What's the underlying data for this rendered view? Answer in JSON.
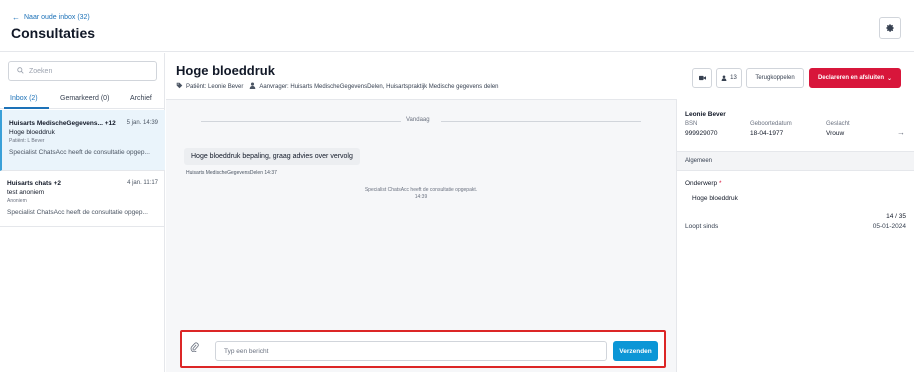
{
  "header": {
    "back_link": "Naar oude inbox (32)",
    "title": "Consultaties"
  },
  "sidebar": {
    "search_placeholder": "Zoeken",
    "tabs": [
      {
        "label": "Inbox (2)",
        "active": true
      },
      {
        "label": "Gemarkeerd (0)",
        "active": false
      },
      {
        "label": "Archief",
        "active": false
      }
    ],
    "conversations": [
      {
        "sender": "Huisarts MedischeGegevens...",
        "extra": "+12",
        "time": "5 jan. 14:39",
        "subject": "Hoge bloeddruk",
        "patient": "Patiënt: L Bever",
        "preview": "Specialist ChatsAcc heeft de consultatie opgep..."
      },
      {
        "sender": "Huisarts chats",
        "extra": "+2",
        "time": "4 jan. 11:17",
        "subject": "test anoniem",
        "patient": "Anoniem",
        "preview": "Specialist ChatsAcc heeft de consultatie opgep..."
      }
    ]
  },
  "consultation": {
    "title": "Hoge bloeddruk",
    "patient_label": "Patiënt: Leonie Bever",
    "requester_label": "Aanvrager: Huisarts MedischeGegevensDelen, Huisartspraktijk Medische gegevens delen",
    "participants_count": "13",
    "return_button": "Terugkoppelen",
    "declare_button": "Declareren en afsluiten"
  },
  "chat": {
    "date_divider": "Vandaag",
    "message_text": "Hoge bloeddruk bepaling, graag advies over vervolg",
    "message_meta": "Huisarts MedischeGegevensDelen 14:37",
    "system_message": "Specialist ChatsAcc heeft de consultatie opgepakt.",
    "system_time": "14:39",
    "input_placeholder": "Typ een bericht",
    "send_button": "Verzenden"
  },
  "patient_panel": {
    "name": "Leonie Bever",
    "bsn_label": "BSN",
    "bsn_value": "999929070",
    "dob_label": "Geboortedatum",
    "dob_value": "18-04-1977",
    "gender_label": "Geslacht",
    "gender_value": "Vrouw",
    "section_title": "Algemeen",
    "subject_label": "Onderwerp",
    "subject_required": "*",
    "subject_value": "Hoge bloeddruk",
    "counter": "14 / 35",
    "running_since_label": "Loopt sinds",
    "running_since_value": "05-01-2024"
  },
  "colors": {
    "accent": "#1d72b8",
    "primary_button": "#d8163b",
    "send_button": "#0b96d6",
    "highlight_border": "#dc2626",
    "selected_row": "#eaf4fb"
  }
}
